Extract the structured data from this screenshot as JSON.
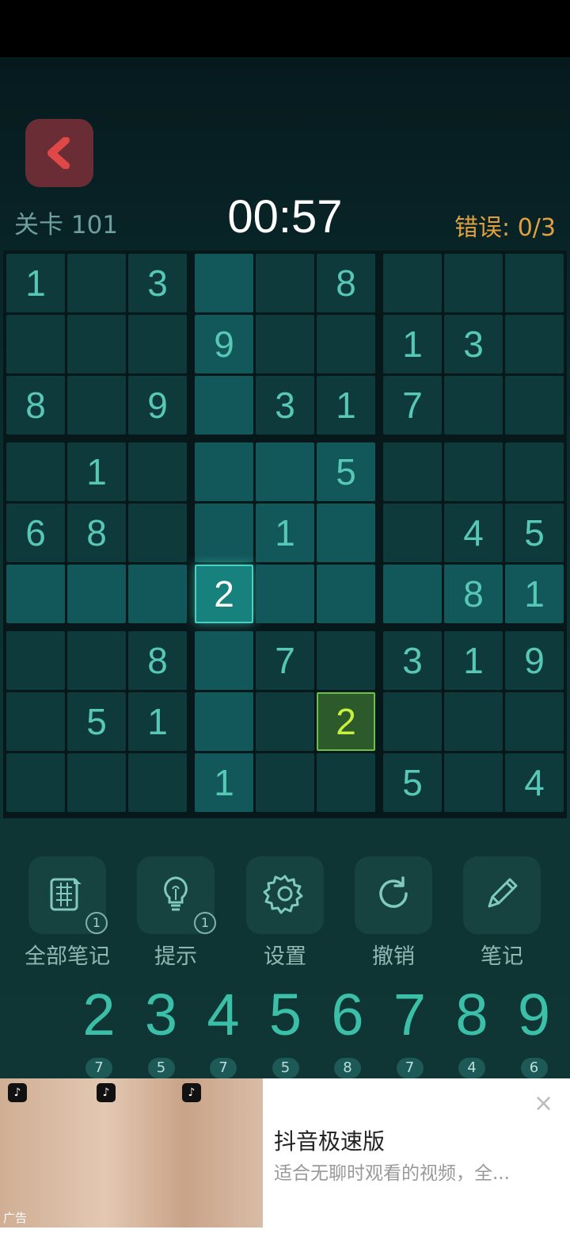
{
  "header": {
    "level": "关卡 101",
    "timer": "00:57",
    "errors": "错误: 0/3"
  },
  "board": {
    "rows": [
      [
        "1",
        "",
        "3",
        "",
        "",
        "8",
        "",
        "",
        ""
      ],
      [
        "",
        "",
        "",
        "9",
        "",
        "",
        "1",
        "3",
        ""
      ],
      [
        "8",
        "",
        "9",
        "",
        "3",
        "1",
        "7",
        "",
        ""
      ],
      [
        "",
        "1",
        "",
        "",
        "",
        "5",
        "",
        "",
        ""
      ],
      [
        "6",
        "8",
        "",
        "",
        "1",
        "",
        "",
        "4",
        "5"
      ],
      [
        "",
        "",
        "",
        "2",
        "",
        "",
        "",
        "8",
        "1"
      ],
      [
        "",
        "",
        "8",
        "",
        "7",
        "",
        "3",
        "1",
        "9"
      ],
      [
        "",
        "5",
        "1",
        "",
        "",
        "2",
        "",
        "",
        ""
      ],
      [
        "",
        "",
        "",
        "1",
        "",
        "",
        "5",
        "",
        "4"
      ]
    ],
    "selected": [
      5,
      3
    ],
    "conflict": [
      7,
      5
    ]
  },
  "tools": [
    {
      "label": "全部笔记",
      "icon": "all-notes-icon",
      "badge": "1"
    },
    {
      "label": "提示",
      "icon": "lightbulb-icon",
      "badge": "1"
    },
    {
      "label": "设置",
      "icon": "gear-icon",
      "badge": ""
    },
    {
      "label": "撤销",
      "icon": "undo-icon",
      "badge": ""
    },
    {
      "label": "笔记",
      "icon": "pencil-icon",
      "badge": ""
    }
  ],
  "numpad": [
    {
      "digit": "2",
      "count": "7"
    },
    {
      "digit": "3",
      "count": "5"
    },
    {
      "digit": "4",
      "count": "7"
    },
    {
      "digit": "5",
      "count": "5"
    },
    {
      "digit": "6",
      "count": "8"
    },
    {
      "digit": "7",
      "count": "7"
    },
    {
      "digit": "8",
      "count": "4"
    },
    {
      "digit": "9",
      "count": "6"
    }
  ],
  "ad": {
    "title": "抖音极速版",
    "description": "适合无聊时观看的视频，全...",
    "label": "广告",
    "close": "×"
  },
  "colors": {
    "accent": "#58c8b6",
    "selected": "#17817e",
    "conflict": "#c8f040",
    "error_text": "#e0a040",
    "back_button": "#6b2d35"
  }
}
